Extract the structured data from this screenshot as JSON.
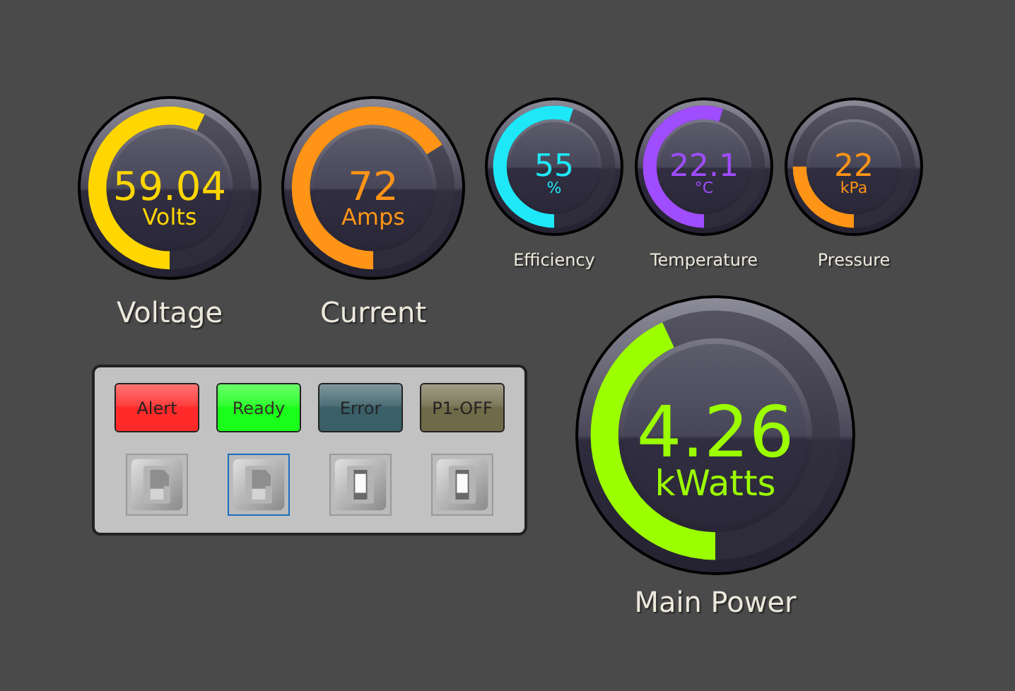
{
  "gauges": [
    {
      "kind": "large",
      "label": "Voltage",
      "value": "59.04",
      "unit": "Volts",
      "level": 0.57,
      "color": "#ffd600"
    },
    {
      "kind": "large",
      "label": "Current",
      "value": "72",
      "unit": "Amps",
      "level": 0.66,
      "color": "#ff9416"
    },
    {
      "kind": "small",
      "label": "Efficiency",
      "value": "55",
      "unit": "%",
      "level": 0.55,
      "color": "#1ee8f8"
    },
    {
      "kind": "small",
      "label": "Temperature",
      "value": "22.1",
      "unit": "°C",
      "level": 0.55,
      "color": "#a04cff"
    },
    {
      "kind": "small",
      "label": "Pressure",
      "value": "22",
      "unit": "kPa",
      "level": 0.25,
      "color": "#ff9416"
    },
    {
      "kind": "main",
      "label": "Main Power",
      "value": "4.26",
      "unit": "kWatts",
      "level": 0.43,
      "color": "#9cff00"
    }
  ],
  "indicators": [
    {
      "label": "Alert",
      "color": "#ff2a2a"
    },
    {
      "label": "Ready",
      "color": "#1aff1a"
    },
    {
      "label": "Error",
      "color": "#3a5f68"
    },
    {
      "label": "P1-OFF",
      "color": "#6f6a48"
    }
  ],
  "switches": [
    {
      "on": true,
      "selected": false
    },
    {
      "on": true,
      "selected": true
    },
    {
      "on": false,
      "selected": false
    },
    {
      "on": false,
      "selected": false
    }
  ]
}
